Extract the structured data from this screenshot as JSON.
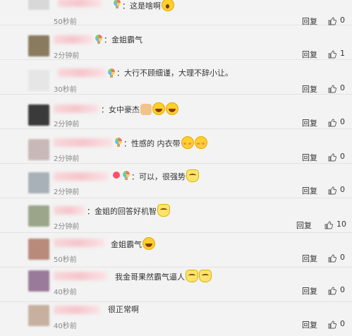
{
  "comments": [
    {
      "text": "：这是啥啊",
      "emojis": [
        "surprise-emoji"
      ],
      "time": "50秒前",
      "reply": "回复",
      "likes": "0"
    },
    {
      "text": "：金姐霸气",
      "emojis": [],
      "time": "2分钟前",
      "reply": "回复",
      "likes": "1"
    },
    {
      "text": "：大行不顾细谨，大理不辞小让。",
      "emojis": [],
      "time": "30秒前",
      "reply": "回复",
      "likes": "0"
    },
    {
      "text": "：女中豪杰",
      "emojis": [
        "thumb-emoji",
        "laugh-emoji",
        "laugh-emoji"
      ],
      "time": "2分钟前",
      "reply": "回复",
      "likes": "0"
    },
    {
      "text": "：性感的 内衣带",
      "emojis": [
        "blush-emoji",
        "blush-emoji"
      ],
      "time": "2分钟前",
      "reply": "回复",
      "likes": "0"
    },
    {
      "text": "：可以，很强势",
      "emojis": [
        "cat-emoji"
      ],
      "time": "2分钟前",
      "reply": "回复",
      "likes": "0"
    },
    {
      "text": "：金姐的回答好机智",
      "emojis": [
        "cat-emoji"
      ],
      "time": "2分钟前",
      "reply": "回复",
      "likes": "10"
    },
    {
      "text": "金姐霸气",
      "emojis": [
        "laugh-emoji"
      ],
      "time": "50秒前",
      "reply": "回复",
      "likes": "0"
    },
    {
      "text": "我金哥果然霸气逼人",
      "emojis": [
        "cat-emoji",
        "cat-emoji"
      ],
      "time": "40秒前",
      "reply": "回复",
      "likes": "0"
    },
    {
      "text": "很正常啊",
      "emojis": [],
      "time": "40秒前",
      "reply": "回复",
      "likes": "0"
    }
  ],
  "avatar_colors": [
    "#d8d8d8",
    "#8a7a5e",
    "#e6e6e6",
    "#3a3a3a",
    "#c9b8b8",
    "#a8b0b8",
    "#9aa58a",
    "#b88a7a",
    "#9a7a9a",
    "#c8b0a0"
  ]
}
